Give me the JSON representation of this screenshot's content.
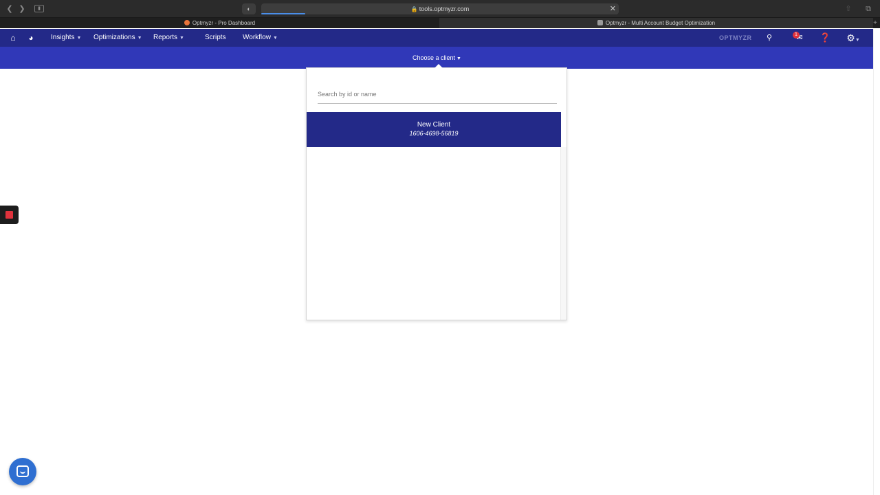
{
  "browser": {
    "url": "tools.optmyzr.com",
    "tabs": [
      {
        "title": "Optmyzr - Pro Dashboard"
      },
      {
        "title": "Optmyzr - Multi Account Budget Optimization"
      }
    ]
  },
  "nav": {
    "items": [
      {
        "label": "Insights"
      },
      {
        "label": "Optimizations"
      },
      {
        "label": "Reports"
      },
      {
        "label": "Scripts"
      },
      {
        "label": "Workflow"
      }
    ],
    "brand": "OPTMYZR",
    "notification_count": "1"
  },
  "client_selector": {
    "label": "Choose a client",
    "search_placeholder": "Search by id or name",
    "clients": [
      {
        "name": "New Client",
        "id": "1606-4698-56819"
      }
    ]
  },
  "colors": {
    "nav_bg": "#232988",
    "subbar_bg": "#3038b8",
    "selected_client_bg": "#232988",
    "chat_button": "#2f6fd1",
    "record_indicator": "#e0323c"
  }
}
